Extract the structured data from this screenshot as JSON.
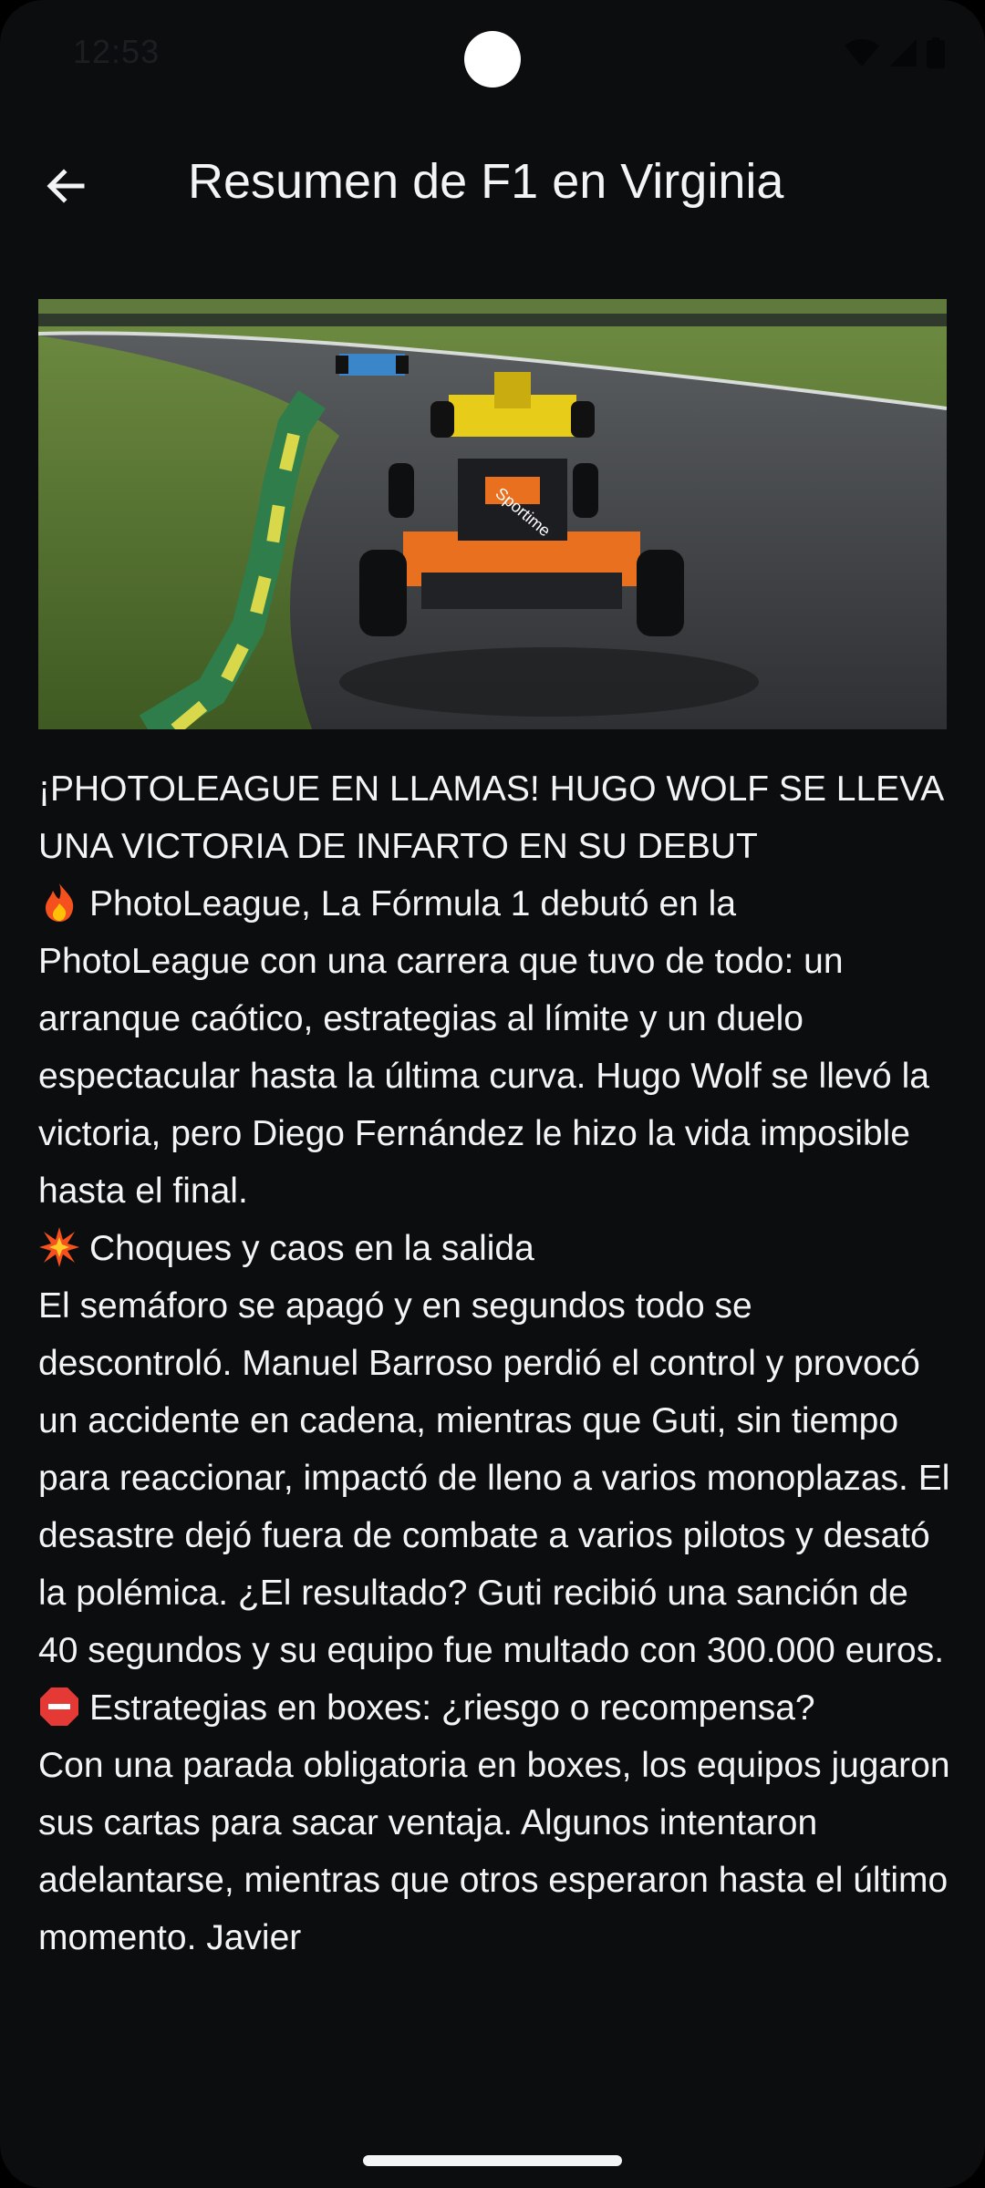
{
  "status_bar": {
    "time": "12:53",
    "icons": [
      "wifi-icon",
      "cell-signal-icon",
      "battery-icon"
    ]
  },
  "app_bar": {
    "back_icon": "arrow-left-icon",
    "title": "Resumen de F1 en Virginia"
  },
  "hero_image": {
    "description": "race-cars-on-track",
    "sponsor_text": "Sportime"
  },
  "article": {
    "headline": "¡PHOTOLEAGUE EN LLAMAS! HUGO WOLF SE LLEVA UNA VICTORIA DE INFARTO EN SU DEBUT",
    "intro_icon": "fire-icon",
    "intro": "PhotoLeague, La Fórmula 1 debutó en la PhotoLeague con una carrera que tuvo de todo: un arranque caótico, estrategias al límite y un duelo espectacular hasta la última curva. Hugo Wolf se llevó la victoria, pero Diego Fernández le hizo la vida imposible hasta el final.",
    "section1_icon": "collision-icon",
    "section1_title": "Choques y caos en la salida",
    "section1_body": "El semáforo se apagó y en segundos todo se descontroló. Manuel Barroso perdió el control y provocó un accidente en cadena, mientras que Guti, sin tiempo para reaccionar, impactó de lleno a varios monoplazas. El desastre dejó fuera de combate a varios pilotos y desató la polémica. ¿El resultado? Guti recibió una sanción de 40 segundos y su equipo fue multado con 300.000 euros.",
    "section2_icon": "stop-sign-icon",
    "section2_title": "Estrategias en boxes: ¿riesgo o recompensa?",
    "section2_body": "Con una parada obligatoria en boxes, los equipos jugaron sus cartas para sacar ventaja. Algunos intentaron adelantarse, mientras que otros esperaron hasta el último momento. Javier"
  },
  "colors": {
    "background": "#0b0d0f",
    "text": "#f2f4f6"
  }
}
